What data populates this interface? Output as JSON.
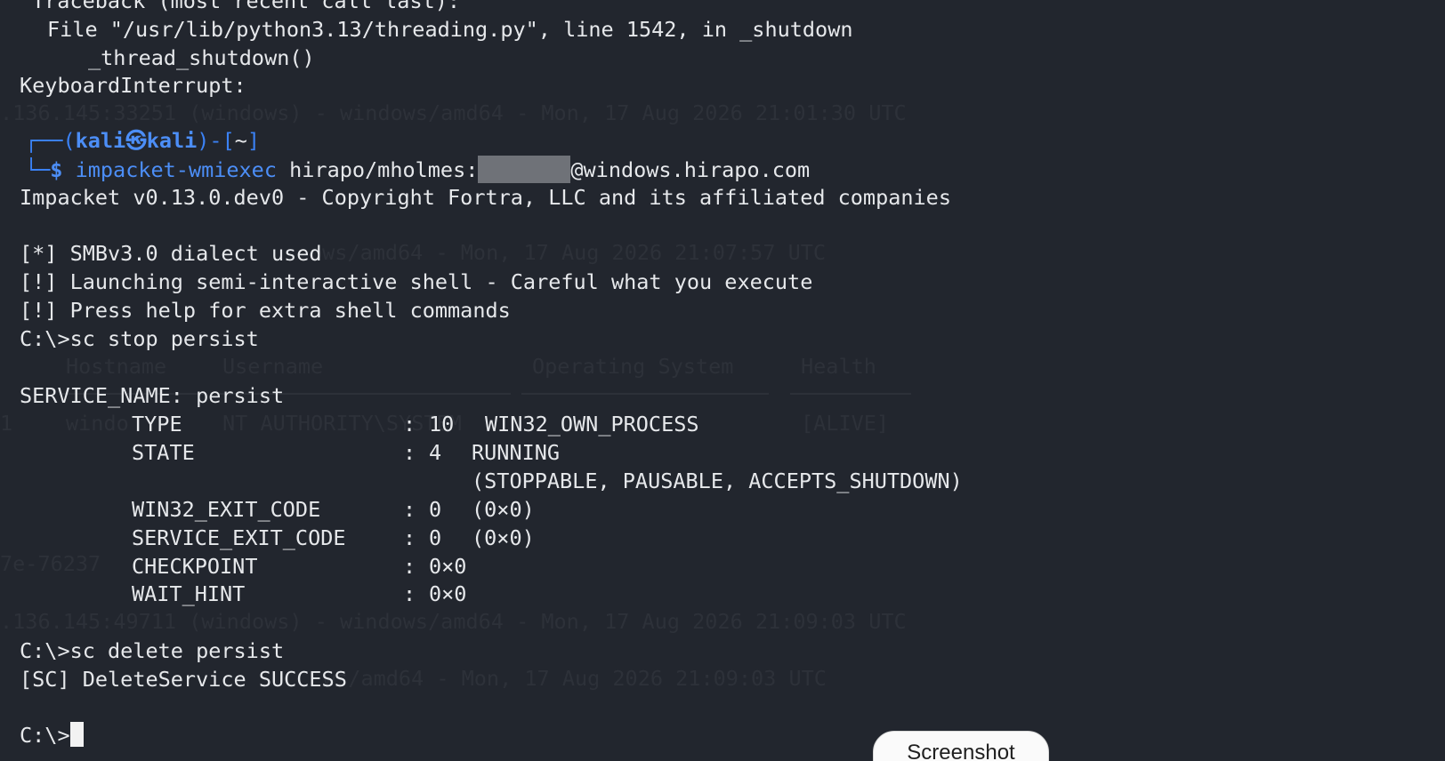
{
  "terminal": {
    "lines": {
      "traceback": "Traceback (most recent call last):",
      "file": "File \"/usr/lib/python3.13/threading.py\", line 1542, in _shutdown",
      "thread_shutdown": "_thread_shutdown()",
      "keyboard_interrupt": "KeyboardInterrupt:",
      "impacket_banner": "Impacket v0.13.0.dev0 - Copyright Fortra, LLC and its affiliated companies",
      "smb_dialect": "[*] SMBv3.0 dialect used",
      "launching": "[!] Launching semi-interactive shell - Careful what you execute",
      "press_help": "[!] Press help for extra shell commands",
      "cmd_stop": "C:\\>sc stop persist",
      "service_name": "SERVICE_NAME: persist",
      "cmd_delete": "C:\\>sc delete persist",
      "delete_success": "[SC] DeleteService SUCCESS",
      "final_prompt": "C:\\>"
    },
    "prompt": {
      "frame_open": "┌──(",
      "user": "kali",
      "at_symbol": "㉿",
      "host": "kali",
      "frame_close": ")-[",
      "cwd": "~",
      "bracket_close": "]",
      "frame_bottom": "└─",
      "dollar": "$",
      "command": "impacket-wmiexec",
      "target_prefix": "hirapo/mholmes:",
      "target_suffix": "@windows.hirapo.com"
    },
    "service_fields": [
      {
        "key": "TYPE",
        "colon": ":",
        "num": "10",
        "text": "WIN32_OWN_PROCESS"
      },
      {
        "key": "STATE",
        "colon": ":",
        "num": "4",
        "text": "RUNNING"
      },
      {
        "key": "",
        "colon": "",
        "num": "",
        "text": "(STOPPABLE, PAUSABLE, ACCEPTS_SHUTDOWN)"
      },
      {
        "key": "WIN32_EXIT_CODE",
        "colon": ":",
        "num": "0",
        "text": "(0×0)"
      },
      {
        "key": "SERVICE_EXIT_CODE",
        "colon": ":",
        "num": "0",
        "text": "(0×0)"
      },
      {
        "key": "CHECKPOINT",
        "colon": ":",
        "num": "0×0",
        "text": ""
      },
      {
        "key": "WAIT_HINT",
        "colon": ":",
        "num": "0×0",
        "text": ""
      }
    ],
    "ghost_text": {
      "g1": ".136.145:33251 (windows) - windows/amd64 - Mon, 17 Aug 2026 21:01:30 UTC",
      "g2": "ows/amd64 - Mon, 17 Aug 2026 21:07:57 UTC",
      "g3_hostname": "Hostname",
      "g3_username": "Username",
      "g3_os": "Operating System",
      "g3_health": "Health",
      "g4_index": "1",
      "g4_host": "windo",
      "g4_user": "NT AUTHORITY\\SYSTEM",
      "g4_health": "[ALIVE]",
      "g5": "7e-76237",
      "g6": ".136.145:49711 (windows) - windows/amd64 - Mon, 17 Aug 2026 21:09:03 UTC",
      "g7": "ws/amd64 - Mon, 17 Aug 2026 21:09:03 UTC"
    }
  },
  "screenshot_badge": {
    "label": "Screenshot"
  },
  "colors": {
    "background": "#22262e",
    "foreground": "#e6e8eb",
    "prompt_blue": "#4c8ef7",
    "ghost": "#2d3139",
    "redaction": "#6f7278"
  }
}
